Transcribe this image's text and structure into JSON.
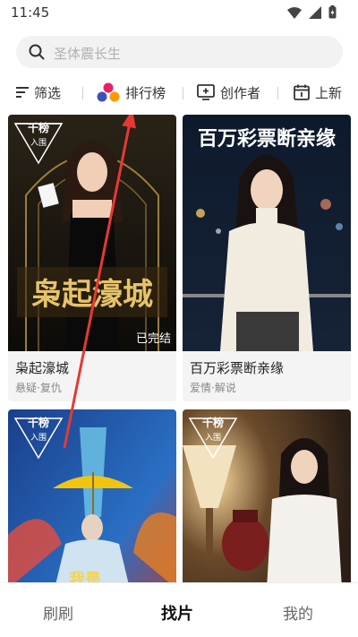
{
  "status": {
    "time": "11:45"
  },
  "search": {
    "placeholder": "圣体震长生"
  },
  "filters": {
    "filter_label": "筛选",
    "ranking_label": "排行榜",
    "creator_label": "创作者",
    "new_label": "上新"
  },
  "cards": [
    {
      "title": "枭起濠城",
      "tags": "悬疑·复仇",
      "badge_top": "千榜",
      "badge_bottom": "入围",
      "poster_title": "枭起濠城",
      "status_tag": "已完结"
    },
    {
      "title": "百万彩票断亲缘",
      "tags": "爱情·解说",
      "poster_title": "百万彩票断亲缘"
    },
    {
      "badge_top": "千榜",
      "badge_bottom": "入围",
      "poster_title": "我是"
    },
    {
      "badge_top": "千榜",
      "badge_bottom": "入围"
    }
  ],
  "nav": {
    "tab1": "刷刷",
    "tab2": "找片",
    "tab3": "我的"
  },
  "colors": {
    "accent": "#e53935",
    "ranking_dots": [
      "#e91e63",
      "#3f51b5",
      "#ff9800"
    ]
  },
  "icons": {
    "search": "search-icon",
    "filter": "filter-icon",
    "ranking": "ranking-icon",
    "creator": "creator-icon",
    "new": "calendar-icon"
  }
}
